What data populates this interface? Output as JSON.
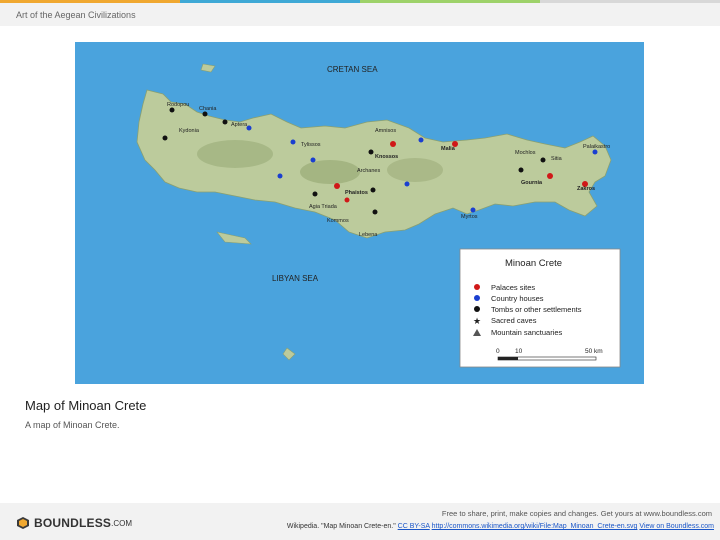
{
  "colors": {
    "bar": [
      "#f0a830",
      "#3fa9d6",
      "#9ed26a",
      "#d0d0d0"
    ],
    "sea": "#4aa3dd",
    "land": "#b9c99a"
  },
  "header": {
    "title": "Art of the Aegean Civilizations"
  },
  "map": {
    "seas": {
      "north": "CRETAN SEA",
      "south": "LIBYAN SEA"
    },
    "labels": [
      "Rodopou",
      "Chania",
      "Aptera",
      "Kydonia",
      "Knossos",
      "Malia",
      "Archanes",
      "Gournia",
      "Zakros",
      "Phaistos",
      "Agia Triada",
      "Kommos",
      "Lebena",
      "Myrtos",
      "Sitia",
      "Palaikastro",
      "Mochlos",
      "Amnisos",
      "Tylissos"
    ],
    "legend": {
      "title": "Minoan Crete",
      "items": [
        {
          "label": "Palaces sites",
          "icon": "red-dot"
        },
        {
          "label": "Country houses",
          "icon": "blue-dot"
        },
        {
          "label": "Tombs or other settlements",
          "icon": "black-dot"
        },
        {
          "label": "Sacred caves",
          "icon": "star"
        },
        {
          "label": "Mountain sanctuaries",
          "icon": "triangle"
        }
      ],
      "scale": {
        "start": "0",
        "mid": "10",
        "end": "50 km"
      }
    }
  },
  "caption": {
    "title": "Map of Minoan Crete",
    "subtitle": "A map of Minoan Crete."
  },
  "footer": {
    "logo": "BOUNDLESS",
    "logo_suffix": ".COM",
    "line1": "Free to share, print, make copies and changes. Get yours at www.boundless.com",
    "line2_prefix": "Wikipedia. \"Map Minoan Crete-en.\" ",
    "license_link": "CC BY-SA",
    "source_link": "http://commons.wikimedia.org/wiki/File:Map_Minoan_Crete-en.svg",
    "view_link": "View on Boundless.com"
  }
}
